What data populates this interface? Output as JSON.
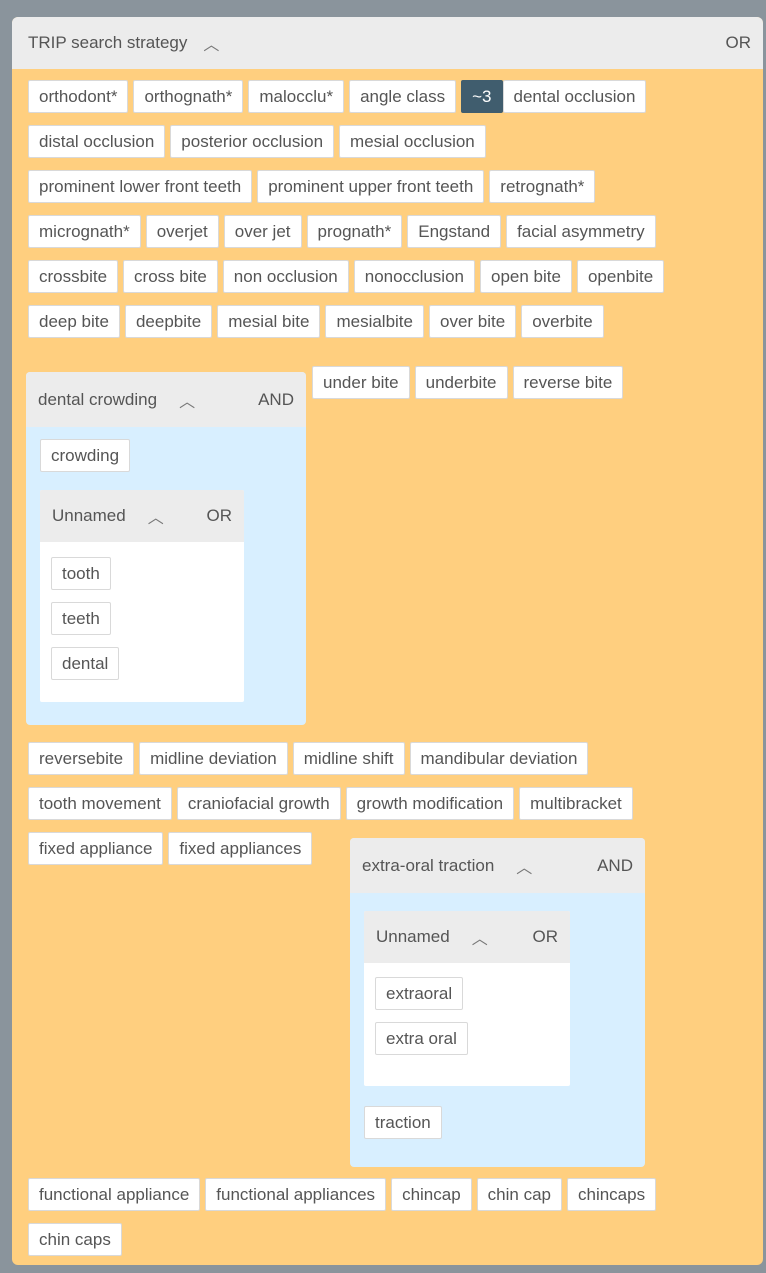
{
  "panel": {
    "title": "TRIP search strategy",
    "operator": "OR"
  },
  "rows": {
    "r1": [
      "orthodont*",
      "orthognath*",
      "malocclu*",
      "angle class"
    ],
    "r1_badge": "~3",
    "r1_after": [
      "dental occlusion"
    ],
    "r2": [
      "distal occlusion",
      "posterior occlusion",
      "mesial occlusion"
    ],
    "r3": [
      "prominent lower front teeth",
      "prominent upper front teeth",
      "retrognath*"
    ],
    "r4": [
      "micrognath*",
      "overjet",
      "over jet",
      "prognath*",
      "Engstand",
      "facial asymmetry"
    ],
    "r5": [
      "crossbite",
      "cross bite",
      "non occlusion",
      "nonocclusion",
      "open bite",
      "openbite"
    ],
    "r6": [
      "deep bite",
      "deepbite",
      "mesial bite",
      "mesialbite",
      "over bite",
      "overbite"
    ],
    "r7": [
      "under bite",
      "underbite",
      "reverse bite"
    ],
    "r8": [
      "reversebite",
      "midline deviation",
      "midline shift",
      "mandibular deviation"
    ],
    "r9": [
      "tooth movement",
      "craniofacial growth",
      "growth modification",
      "multibracket"
    ],
    "r10": [
      "fixed appliance",
      "fixed appliances"
    ],
    "r11": [
      "functional appliance",
      "functional appliances",
      "chincap",
      "chin cap",
      "chincaps"
    ],
    "r12": [
      "chin caps"
    ]
  },
  "group_crowding": {
    "title": "dental crowding",
    "operator": "AND",
    "terms": [
      "crowding"
    ],
    "sub": {
      "title": "Unnamed",
      "operator": "OR",
      "terms": [
        "tooth",
        "teeth",
        "dental"
      ]
    }
  },
  "group_traction": {
    "title": "extra-oral traction",
    "operator": "AND",
    "sub": {
      "title": "Unnamed",
      "operator": "OR",
      "terms": [
        "extraoral",
        "extra oral"
      ]
    },
    "terms": [
      "traction"
    ]
  },
  "icons": {
    "collapse": "chevron-up-icon"
  },
  "colors": {
    "panel_bg": "#ffcf7f",
    "group_bg": "#d8efff",
    "header_bg": "#ececec",
    "badge_bg": "#405d6e"
  }
}
